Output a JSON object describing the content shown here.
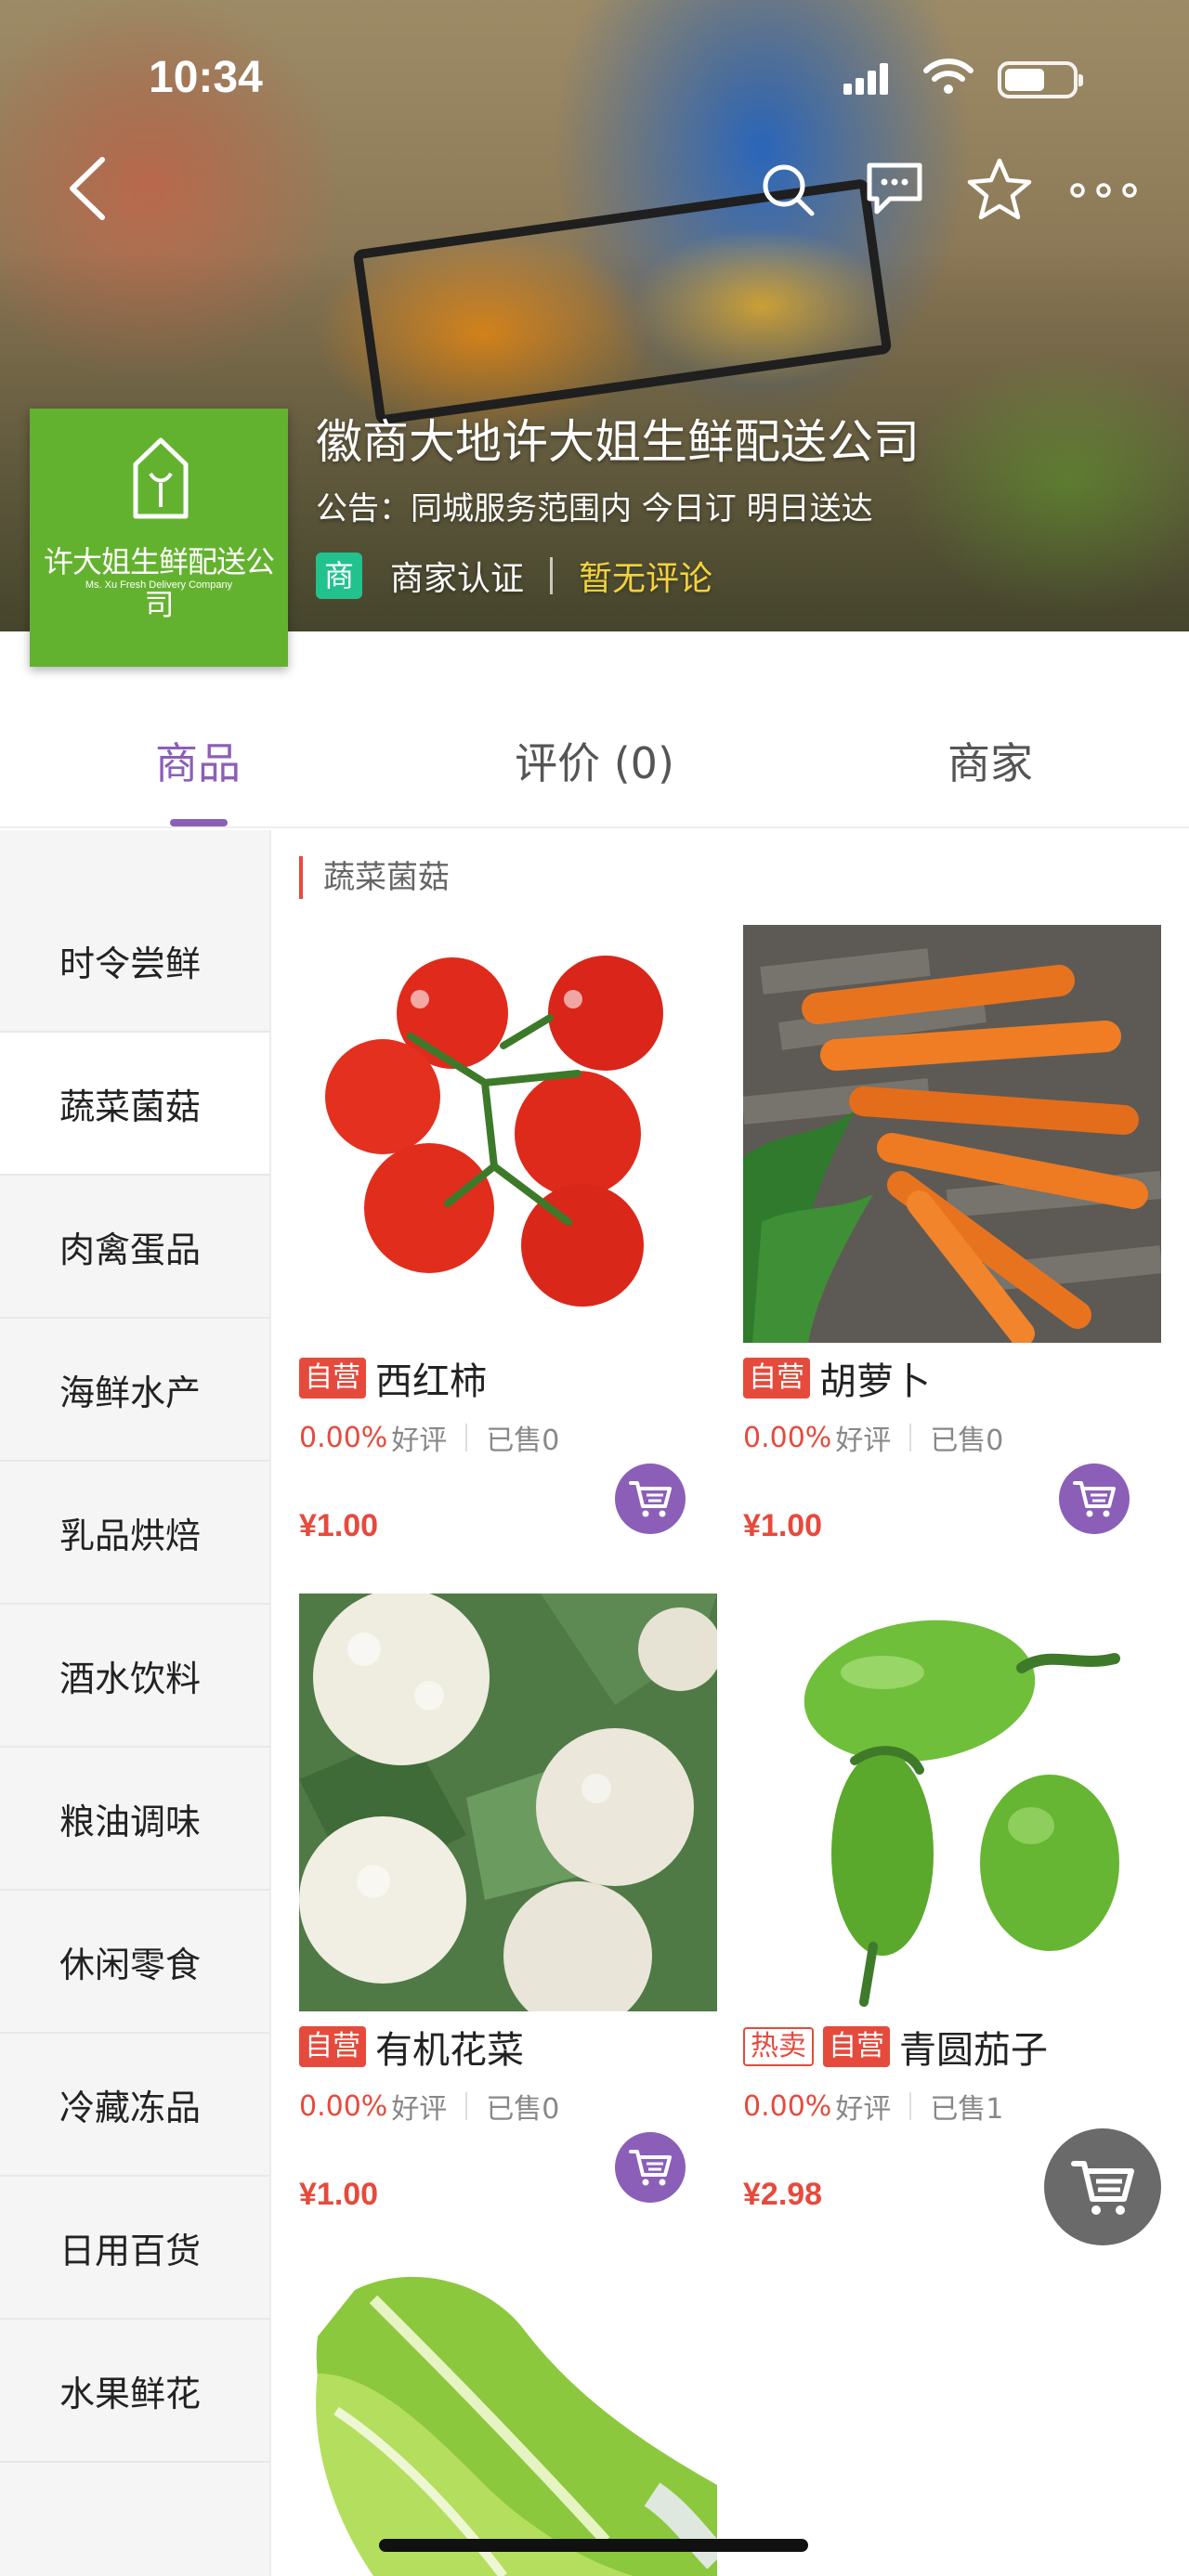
{
  "status_bar": {
    "time": "10:34",
    "battery_level": 0.6
  },
  "shop": {
    "name": "徽商大地许大姐生鲜配送公司",
    "notice": "公告：同城服务范围内 今日订 明日送达",
    "badge": "商",
    "cert_label": "商家认证",
    "review_status": "暂无评论",
    "logo_cn": "许大姐生鲜配送公司",
    "logo_en": "Ms. Xu Fresh Delivery Company"
  },
  "tabs": [
    {
      "label": "商品",
      "active": true
    },
    {
      "label": "评价 (0)",
      "active": false
    },
    {
      "label": "商家",
      "active": false
    }
  ],
  "categories": [
    {
      "label": "时令尝鲜",
      "active": false
    },
    {
      "label": "蔬菜菌菇",
      "active": true
    },
    {
      "label": "肉禽蛋品",
      "active": false
    },
    {
      "label": "海鲜水产",
      "active": false
    },
    {
      "label": "乳品烘焙",
      "active": false
    },
    {
      "label": "酒水饮料",
      "active": false
    },
    {
      "label": "粮油调味",
      "active": false
    },
    {
      "label": "休闲零食",
      "active": false
    },
    {
      "label": "冷藏冻品",
      "active": false
    },
    {
      "label": "日用百货",
      "active": false
    },
    {
      "label": "水果鲜花",
      "active": false
    }
  ],
  "section_title": "蔬菜菌菇",
  "labels": {
    "self_operated": "自营",
    "hot": "热卖",
    "good_review": "好评",
    "sold_prefix": "已售"
  },
  "products": [
    {
      "name": "西红柿",
      "rating": "0.00%",
      "sold": "已售0",
      "price": "¥1.00",
      "tags": [
        "自营"
      ]
    },
    {
      "name": "胡萝卜",
      "rating": "0.00%",
      "sold": "已售0",
      "price": "¥1.00",
      "tags": [
        "自营"
      ]
    },
    {
      "name": "有机花菜",
      "rating": "0.00%",
      "sold": "已售0",
      "price": "¥1.00",
      "tags": [
        "自营"
      ]
    },
    {
      "name": "青圆茄子",
      "rating": "0.00%",
      "sold": "已售1",
      "price": "¥2.98",
      "tags": [
        "热卖",
        "自营"
      ]
    }
  ],
  "colors": {
    "accent": "#8b5fb8",
    "price": "#e64a3c",
    "badge_green": "#22c28e",
    "logo_green": "#63b22f",
    "review_yellow": "#f4d23b"
  }
}
